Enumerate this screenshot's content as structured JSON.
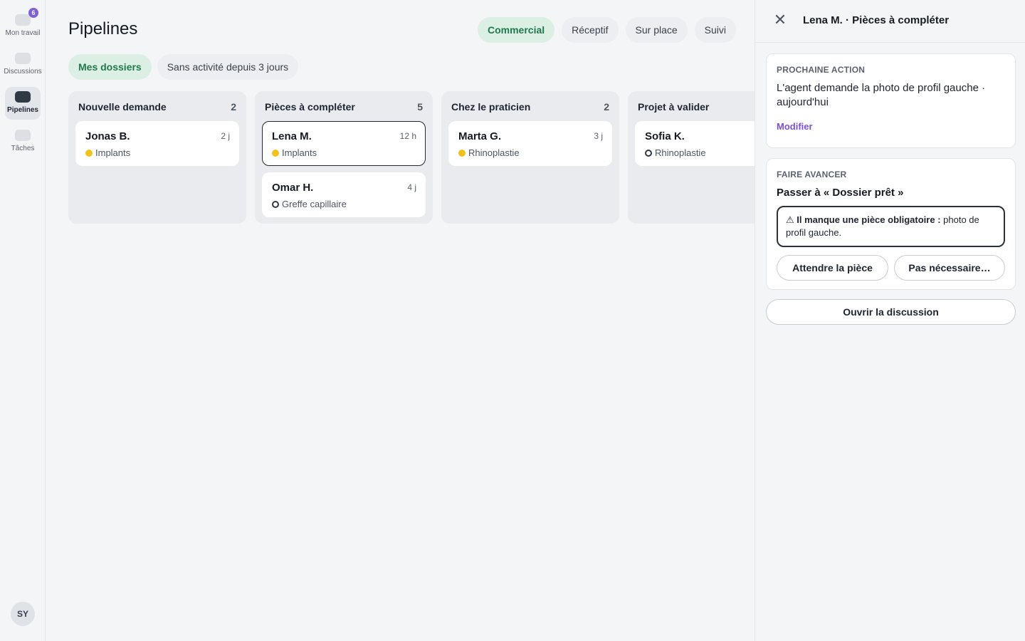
{
  "rail": {
    "items": [
      {
        "label": "Mon travail",
        "badge": "6"
      },
      {
        "label": "Discussions"
      },
      {
        "label": "Pipelines"
      },
      {
        "label": "Tâches"
      }
    ],
    "avatar": "SY"
  },
  "header": {
    "title": "Pipelines",
    "tabs": [
      "Commercial",
      "Réceptif",
      "Sur place",
      "Suivi"
    ]
  },
  "filters": [
    "Mes dossiers",
    "Sans activité depuis 3 jours"
  ],
  "columns": [
    {
      "title": "Nouvelle demande",
      "count": "2",
      "cards": [
        {
          "name": "Jonas B.",
          "age": "2 j",
          "tag": "Implants",
          "dot": "filled"
        }
      ]
    },
    {
      "title": "Pièces à compléter",
      "count": "5",
      "cards": [
        {
          "name": "Lena M.",
          "age": "12 h",
          "tag": "Implants",
          "dot": "filled"
        },
        {
          "name": "Omar H.",
          "age": "4 j",
          "tag": "Greffe capillaire",
          "dot": "hollow"
        }
      ]
    },
    {
      "title": "Chez le praticien",
      "count": "2",
      "cards": [
        {
          "name": "Marta G.",
          "age": "3 j",
          "tag": "Rhinoplastie",
          "dot": "filled"
        }
      ]
    },
    {
      "title": "Projet à valider",
      "count": "",
      "cards": [
        {
          "name": "Sofia K.",
          "age": "",
          "tag": "Rhinoplastie",
          "dot": "hollow"
        }
      ]
    }
  ],
  "panel": {
    "title": "Lena M. · Pièces à compléter",
    "next_action": {
      "label": "PROCHAINE ACTION",
      "text": "L'agent demande la photo de profil gauche · aujourd'hui",
      "modify": "Modifier"
    },
    "advance": {
      "label": "FAIRE AVANCER",
      "title": "Passer à « Dossier prêt »",
      "warning_bold": "⚠ Il manque une pièce obligatoire :",
      "warning_text": " photo de profil gauche.",
      "btn_wait": "Attendre la pièce",
      "btn_skip": "Pas nécessaire…"
    },
    "open_discussion": "Ouvrir la discussion"
  },
  "colors": {
    "accent_green": "#1e7a4a",
    "accent_green_bg": "#dcefe5",
    "badge_purple": "#7b61d8",
    "link_purple": "#7b4fd4",
    "dot_yellow": "#f2c11c"
  }
}
